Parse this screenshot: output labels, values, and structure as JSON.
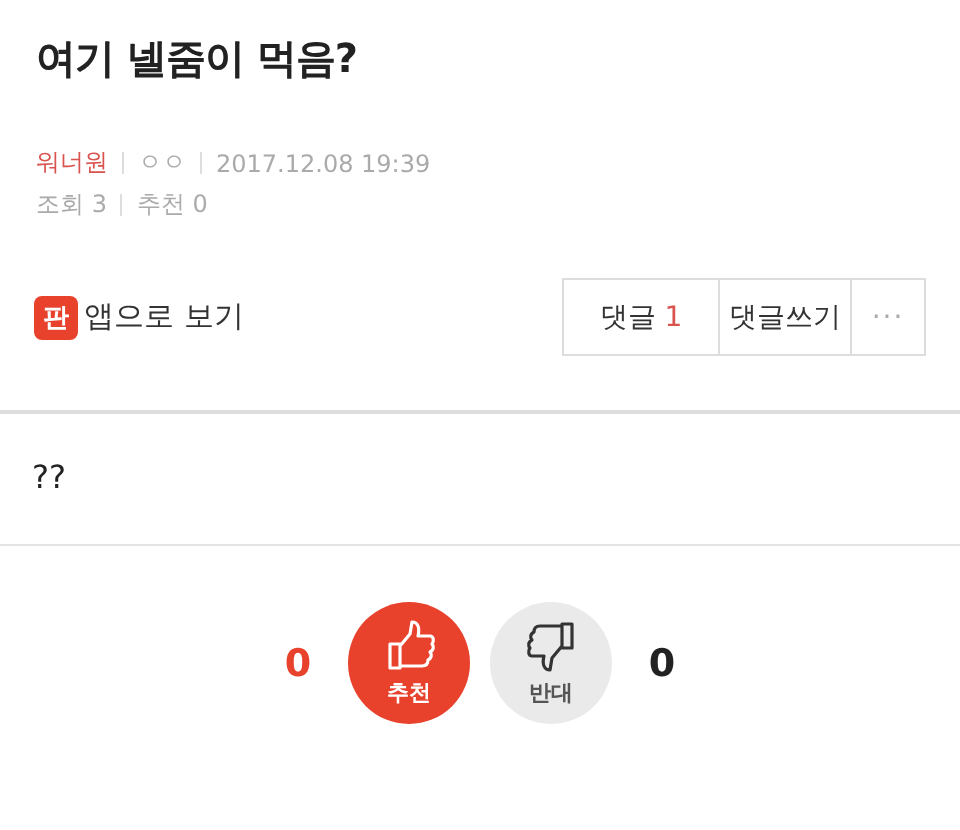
{
  "title": "여기 넬줌이 먹음?",
  "meta": {
    "author": "워너원",
    "nickname": "ㅇㅇ",
    "date": "2017.12.08 19:39",
    "views": "조회 3",
    "recommends": "추천 0"
  },
  "app_link": {
    "icon": "판",
    "label": "앱으로 보기"
  },
  "actions": {
    "comments_label": "댓글",
    "comments_count": "1",
    "write_label": "댓글쓰기",
    "more": "···"
  },
  "body": "??",
  "votes": {
    "up_count": "0",
    "up_label": "추천",
    "down_label": "반대",
    "down_count": "0"
  }
}
